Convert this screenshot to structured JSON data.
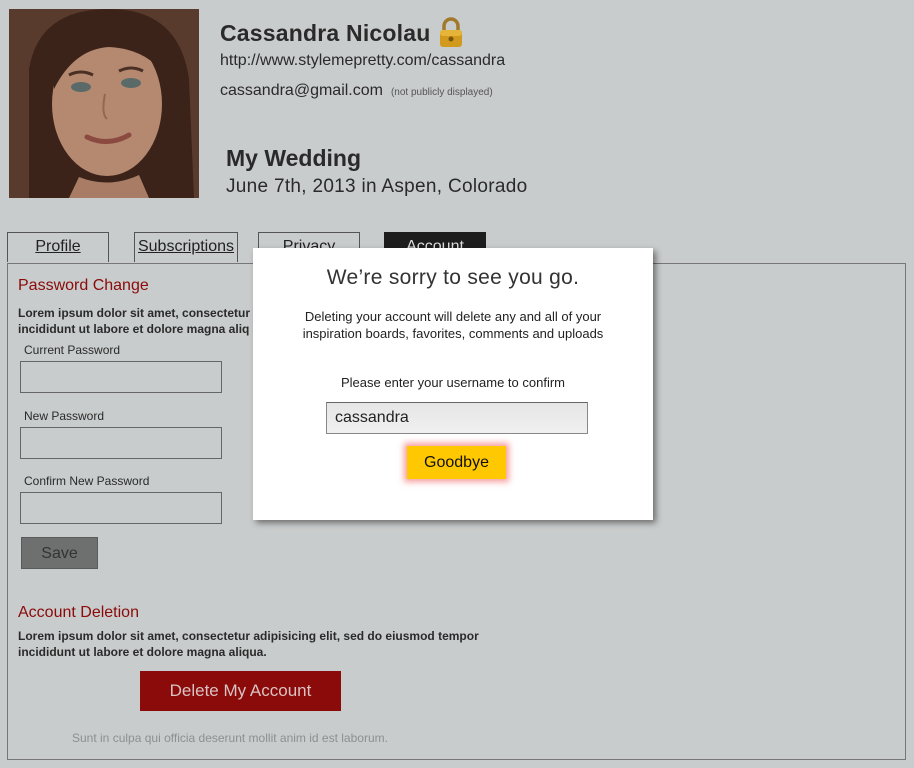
{
  "profile": {
    "name": "Cassandra Nicolau",
    "url": "http://www.stylemepretty.com/cassandra",
    "email": "cassandra@gmail.com",
    "email_note": "(not publicly displayed)",
    "wedding_title": "My Wedding",
    "wedding_date": "June 7th, 2013 in Aspen, Colorado"
  },
  "tabs": [
    {
      "label": "Profile"
    },
    {
      "label": "Subscriptions"
    },
    {
      "label": "Privacy"
    },
    {
      "label": "Account",
      "active": true
    }
  ],
  "password_change": {
    "title": "Password Change",
    "desc_line1": "Lorem ipsum dolor sit amet, consectetur a",
    "desc_line2": "incididunt ut labore et dolore magna aliq",
    "current_label": "Current Password",
    "new_label": "New Password",
    "confirm_label": "Confirm New Password",
    "save_label": "Save"
  },
  "account_deletion": {
    "title": "Account Deletion",
    "desc_line1": "Lorem ipsum dolor sit amet, consectetur adipisicing elit, sed do eiusmod tempor",
    "desc_line2": "incididunt ut labore et dolore magna aliqua.",
    "delete_label": "Delete My Account",
    "footnote": "Sunt in culpa qui officia deserunt mollit anim id est laborum."
  },
  "modal": {
    "title": "We’re sorry to see you go.",
    "body_line1": "Deleting your account will delete any and all of your",
    "body_line2": "inspiration boards, favorites, comments and uploads",
    "prompt": "Please enter your username to confirm",
    "username_value": "cassandra",
    "goodbye_label": "Goodbye"
  },
  "colors": {
    "overlay_bg": "#c9cccc",
    "section_title": "#8b0a0a",
    "delete_button": "#8b0a0a",
    "goodbye_button": "#ffc800",
    "active_tab": "#1d1d1d"
  },
  "icons": [
    "lock-icon"
  ]
}
